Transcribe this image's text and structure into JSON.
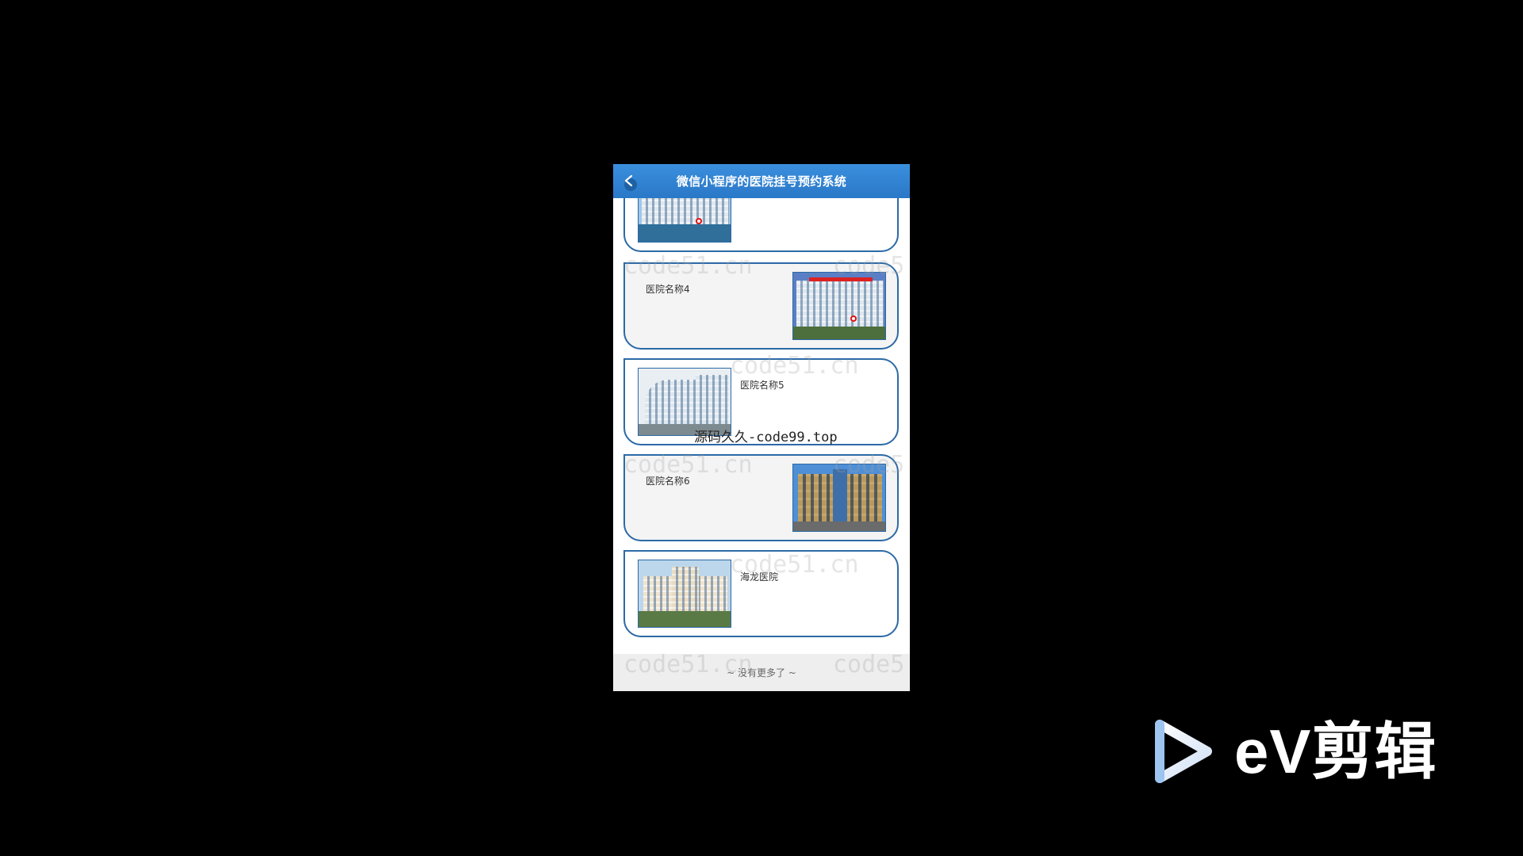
{
  "app": {
    "title": "微信小程序的医院挂号预约系统"
  },
  "hospitals": [
    {
      "name": "",
      "image_side": "left"
    },
    {
      "name": "医院名称4",
      "image_side": "right"
    },
    {
      "name": "医院名称5",
      "image_side": "left"
    },
    {
      "name": "医院名称6",
      "image_side": "right"
    },
    {
      "name": "海龙医院",
      "image_side": "left"
    }
  ],
  "footer": {
    "no_more": "~ 没有更多了 ~"
  },
  "watermarks": {
    "site": "code51.cn",
    "site_partial": "code5",
    "overlay": "源码久久-code99.top"
  },
  "editor_logo": {
    "brand": "eV剪辑"
  },
  "icons": {
    "back": "chevron-left-icon",
    "logo": "play-triangle-icon"
  },
  "colors": {
    "header": "#2a78c8",
    "card_border": "#2c6aa6",
    "background": "#000000"
  }
}
